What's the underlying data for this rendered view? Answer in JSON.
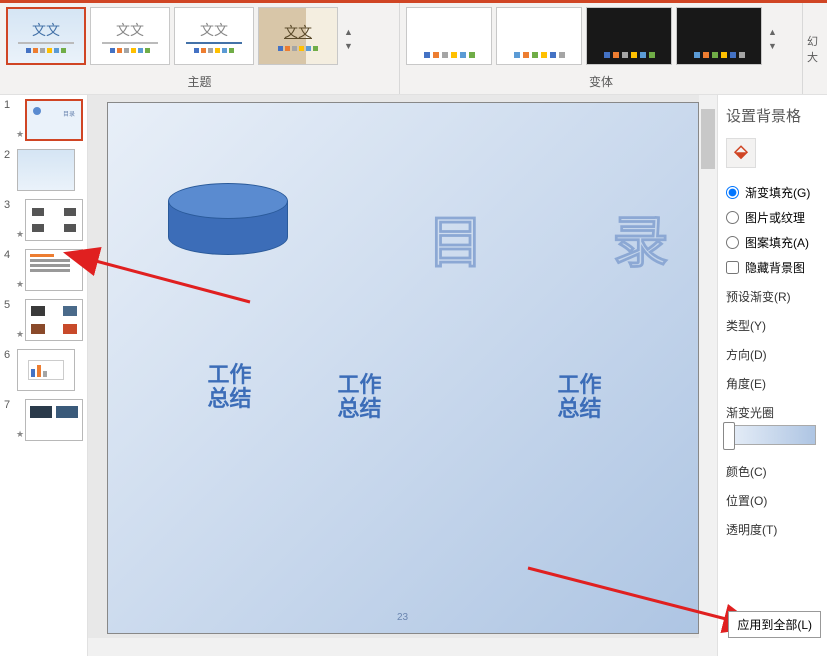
{
  "ribbon": {
    "theme_label": "主题",
    "variant_label": "变体",
    "theme_text": "文文",
    "right_extra_1": "幻",
    "right_extra_2": "大"
  },
  "thumbnails": [
    {
      "num": "1"
    },
    {
      "num": "2"
    },
    {
      "num": "3"
    },
    {
      "num": "4"
    },
    {
      "num": "5"
    },
    {
      "num": "6"
    },
    {
      "num": "7"
    }
  ],
  "slide": {
    "char1": "目",
    "char2": "录",
    "work1_a": "工作",
    "work1_b": "总结",
    "work2_a": "工作",
    "work2_b": "总结",
    "work3_a": "工作",
    "work3_b": "总结",
    "page_num": "23"
  },
  "panel": {
    "title": "设置背景格",
    "fill_gradient": "渐变填充(G)",
    "fill_picture": "图片或纹理",
    "fill_pattern": "图案填充(A)",
    "hide_bg": "隐藏背景图",
    "preset": "预设渐变(R)",
    "type": "类型(Y)",
    "direction": "方向(D)",
    "angle": "角度(E)",
    "grad_stops": "渐变光圈",
    "color": "颜色(C)",
    "position": "位置(O)",
    "transparency": "透明度(T)",
    "apply_all": "应用到全部(L)"
  }
}
